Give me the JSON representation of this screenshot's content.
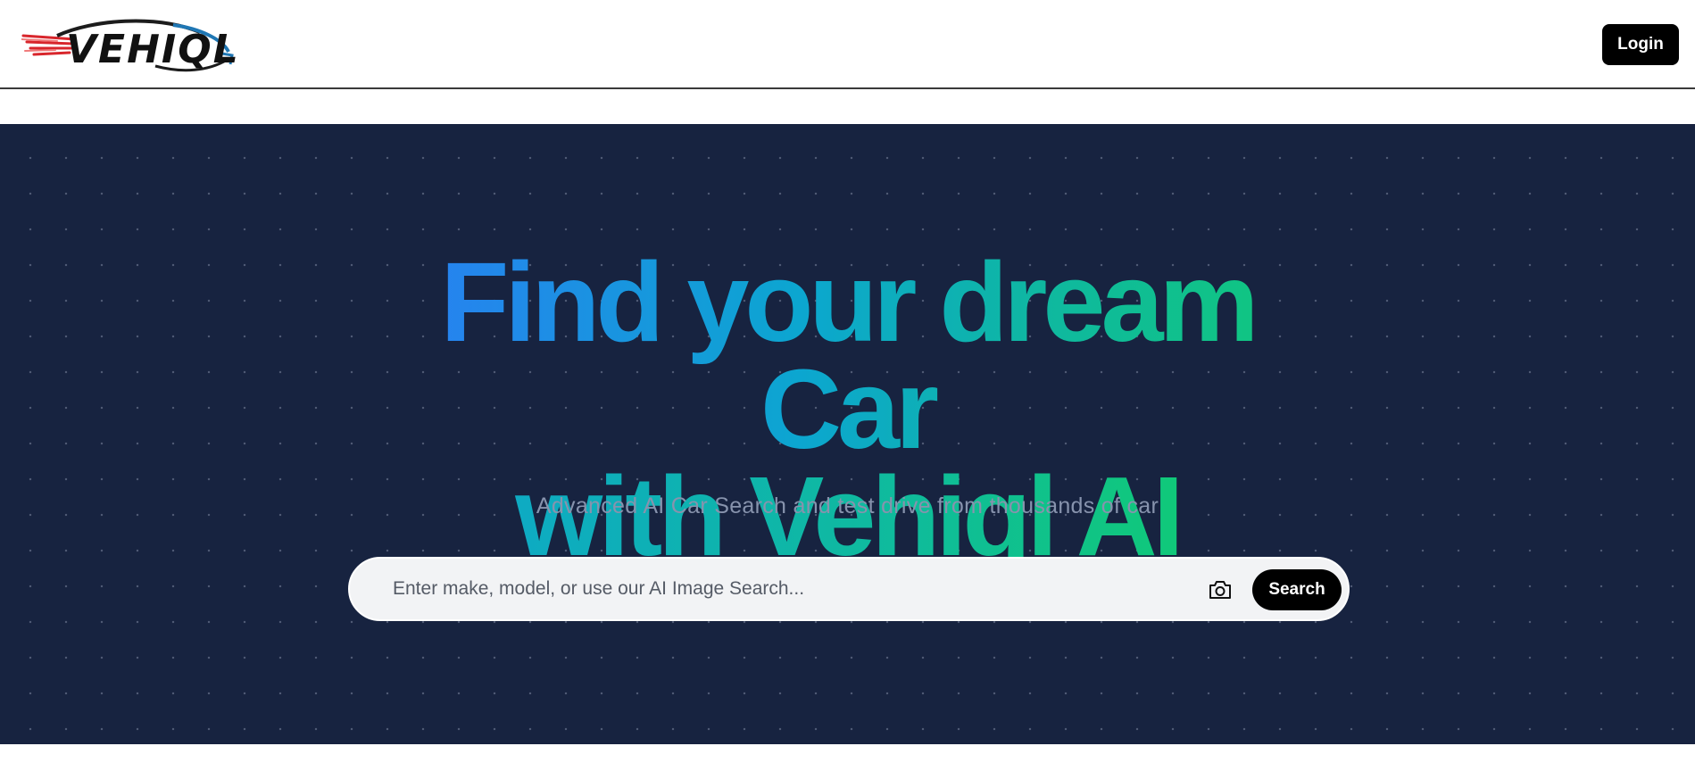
{
  "navbar": {
    "logo_text": "VEHIQL",
    "login_label": "Login"
  },
  "hero": {
    "headline_line1": "Find your dream Car",
    "headline_line2": "with Vehiql AI",
    "subtitle": "Advanced AI Car Search and test drive from thousands of car",
    "gradient_colors": [
      "#2b7cf5",
      "#0ca6d0",
      "#10c978"
    ],
    "background_color": "#172340"
  },
  "search": {
    "placeholder": "Enter make, model, or use our AI Image Search...",
    "value": "",
    "camera_icon": "camera-icon",
    "button_label": "Search"
  }
}
